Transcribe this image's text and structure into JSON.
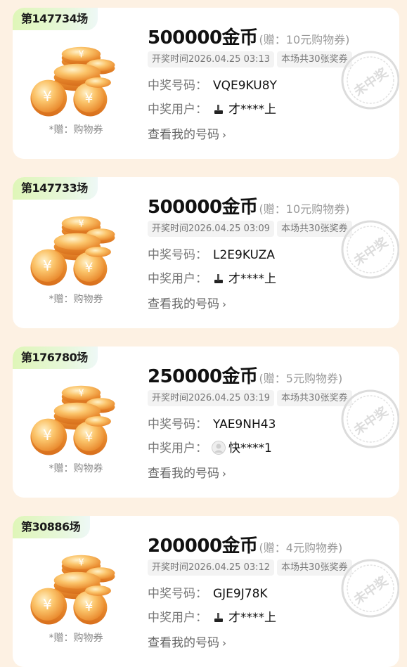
{
  "labels": {
    "open_time_prefix": "开奖时间",
    "winning_number": "中奖号码：",
    "winning_user": "中奖用户：",
    "view_my_numbers": "查看我的号码",
    "gift_left": "*赠：购物券",
    "stamp_text": "未中奖"
  },
  "colors": {
    "page_bg": "#fdf1e3",
    "card_bg": "#ffffff",
    "badge_gradient_start": "#dff6b8",
    "coin_gold": "#f5a524",
    "stamp_gray": "#dcdcdc"
  },
  "cards": [
    {
      "round": "第147734场",
      "amount": "500000金币",
      "gift": "(赠：10元购物券)",
      "open_time": "开奖时间2026.04.25 03:13",
      "total_tickets": "本场共30张奖券",
      "winning_number": "VQE9KU8Y",
      "winner": "才****上",
      "winner_avatar": "dark-avatar-icon"
    },
    {
      "round": "第147733场",
      "amount": "500000金币",
      "gift": "(赠：10元购物券)",
      "open_time": "开奖时间2026.04.25 03:09",
      "total_tickets": "本场共30张奖券",
      "winning_number": "L2E9KUZA",
      "winner": "才****上",
      "winner_avatar": "dark-avatar-icon"
    },
    {
      "round": "第176780场",
      "amount": "250000金币",
      "gift": "(赠：5元购物券)",
      "open_time": "开奖时间2026.04.25 03:19",
      "total_tickets": "本场共30张奖券",
      "winning_number": "YAE9NH43",
      "winner": "快****1",
      "winner_avatar": "default-avatar-icon"
    },
    {
      "round": "第30886场",
      "amount": "200000金币",
      "gift": "(赠：4元购物券)",
      "open_time": "开奖时间2026.04.25 03:12",
      "total_tickets": "本场共30张奖券",
      "winning_number": "GJE9J78K",
      "winner": "才****上",
      "winner_avatar": "dark-avatar-icon"
    }
  ]
}
